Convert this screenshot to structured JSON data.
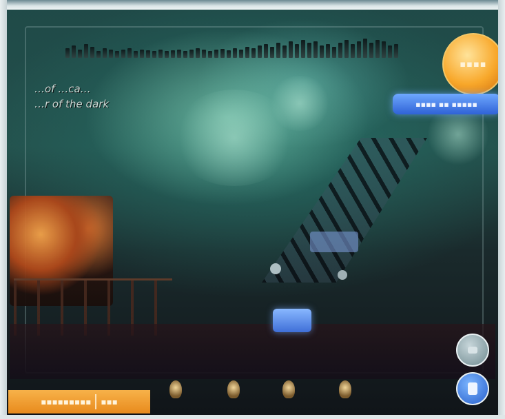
{
  "scene": {
    "title_line1": "…of …ca…",
    "title_line2": "…r of the dark"
  },
  "hud": {
    "orange_badge_text": "▪▪▪▪",
    "blue_pill_text": "▪▪▪▪ ▪▪ ▪▪▪▪▪",
    "bottom_label_left": "▪▪▪▪▪▪▪▪▪",
    "bottom_label_right": "▪▪▪"
  },
  "icons": {
    "up_button": "up-arrow-icon",
    "down_button": "pause-icon",
    "lamps": "lamp-icon"
  },
  "colors": {
    "badge_orange": "#f8a82b",
    "pill_blue": "#2f62d6",
    "sky_teal": "#234f4b"
  }
}
